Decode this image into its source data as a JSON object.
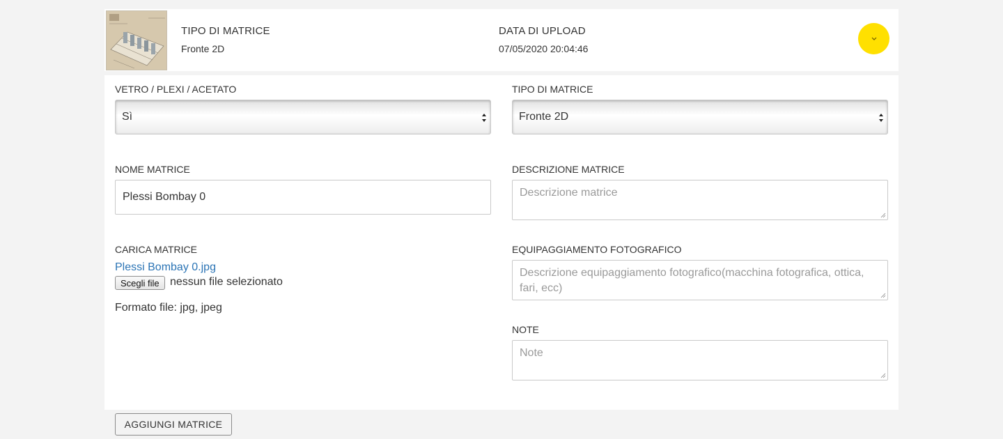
{
  "header": {
    "tipo_label": "TIPO DI MATRICE",
    "tipo_value": "Fronte 2D",
    "data_label": "DATA DI UPLOAD",
    "data_value": "07/05/2020 20:04:46"
  },
  "form": {
    "vetro": {
      "label": "VETRO / PLEXI / ACETATO",
      "value": "Sì"
    },
    "tipo": {
      "label": "TIPO DI MATRICE",
      "value": "Fronte 2D"
    },
    "nome": {
      "label": "NOME MATRICE",
      "value": "Plessi Bombay 0"
    },
    "descrizione": {
      "label": "DESCRIZIONE MATRICE",
      "placeholder": "Descrizione matrice"
    },
    "carica": {
      "label": "CARICA MATRICE",
      "file_link": "Plessi Bombay 0.jpg",
      "choose_button": "Scegli file",
      "no_file": "nessun file selezionato",
      "format_note": "Formato file: jpg, jpeg"
    },
    "equipaggiamento": {
      "label": "EQUIPAGGIAMENTO FOTOGRAFICO",
      "placeholder": "Descrizione equipaggiamento fotografico(macchina fotografica, ottica, fari, ecc)"
    },
    "note": {
      "label": "NOTE",
      "placeholder": "Note"
    }
  },
  "actions": {
    "add_label": "AGGIUNGI MATRICE"
  },
  "colors": {
    "accent": "#ffe000",
    "link": "#2b74b5"
  },
  "icons": {
    "toggle": "chevron-down-icon",
    "select": "select-arrows-icon"
  }
}
